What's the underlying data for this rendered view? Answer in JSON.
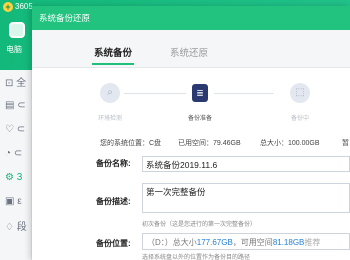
{
  "app": {
    "version": "3605",
    "logo_glyph": "+",
    "header_label": "电脑",
    "nav_glyphs": [
      "⊡ 全",
      "▤ ⊂",
      "♡ ⊂",
      "◔ ⊂",
      "⚙ 3",
      "▣ ε",
      "♢ 段"
    ]
  },
  "dialog": {
    "title": "系统备份还原",
    "tabs": {
      "backup": "系统备份",
      "restore": "系统还原"
    },
    "steps": [
      {
        "label": "环境检测",
        "icon": "search-icon",
        "glyph": "⌕"
      },
      {
        "label": "备份准备",
        "icon": "clipboard-icon",
        "glyph": "≣"
      },
      {
        "label": "备份中",
        "icon": "backup-progress-icon",
        "glyph": "⬚"
      }
    ],
    "info": {
      "system_location": "您的系统位置：C盘",
      "used_space": "已用空间：79.46GB",
      "total_size": "总大小：100.00GB",
      "more": "暂"
    },
    "form": {
      "name_label": "备份名称:",
      "name_value": "系统备份2019.11.6",
      "desc_label": "备份描述:",
      "desc_value": "第一次完整备份",
      "desc_hint": "初次备份（这是您进行的第一次完整备份）",
      "location_label": "备份位置:",
      "location_prefix": "（D：）总大小",
      "location_total": "177.67GB",
      "location_mid": "，可用空间",
      "location_free": "81.18GB",
      "location_suffix": "推荐",
      "location_hint": "选择系统盘以外的位置作为备份目的路径"
    }
  },
  "colors": {
    "accent": "#1fbf7c",
    "link": "#1e7fd8",
    "active_step": "#2a3a70"
  }
}
